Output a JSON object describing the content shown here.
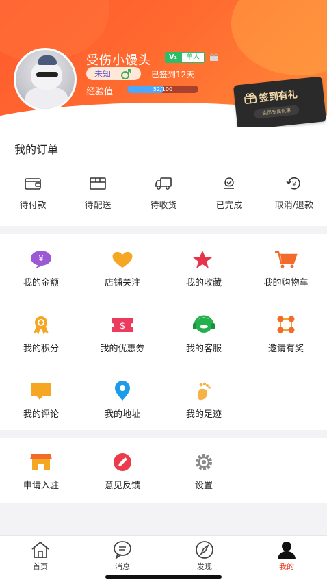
{
  "profile": {
    "username": "受伤小馒头",
    "vip_badge": "V₁",
    "vip_label": "单人",
    "gender_text": "未知",
    "signin_days": "已签到12天",
    "exp_label": "经验值",
    "exp_text": "52/100",
    "exp_progress": 0.52
  },
  "signin_card": {
    "title": "签到有礼",
    "subtitle": "会员专属优惠"
  },
  "orders": {
    "title": "我的订单",
    "items": [
      {
        "label": "待付款",
        "icon": "wallet-icon"
      },
      {
        "label": "待配送",
        "icon": "package-icon"
      },
      {
        "label": "待收货",
        "icon": "truck-icon"
      },
      {
        "label": "已完成",
        "icon": "check-flower-icon"
      },
      {
        "label": "取消/退款",
        "icon": "refund-icon"
      }
    ]
  },
  "services": [
    {
      "label": "我的金额",
      "icon": "money-icon"
    },
    {
      "label": "店铺关注",
      "icon": "heart-icon"
    },
    {
      "label": "我的收藏",
      "icon": "star-icon"
    },
    {
      "label": "我的购物车",
      "icon": "cart-icon"
    },
    {
      "label": "我的积分",
      "icon": "medal-icon"
    },
    {
      "label": "我的优惠券",
      "icon": "coupon-icon"
    },
    {
      "label": "我的客服",
      "icon": "headset-icon"
    },
    {
      "label": "邀请有奖",
      "icon": "invite-icon"
    },
    {
      "label": "我的评论",
      "icon": "comment-icon"
    },
    {
      "label": "我的地址",
      "icon": "location-icon"
    },
    {
      "label": "我的足迹",
      "icon": "footprint-icon"
    }
  ],
  "more": [
    {
      "label": "申请入驻",
      "icon": "store-icon"
    },
    {
      "label": "意见反馈",
      "icon": "feedback-icon"
    },
    {
      "label": "设置",
      "icon": "settings-icon"
    }
  ],
  "tabbar": [
    {
      "label": "首页",
      "icon": "home-icon"
    },
    {
      "label": "消息",
      "icon": "message-icon"
    },
    {
      "label": "发现",
      "icon": "compass-icon"
    },
    {
      "label": "我的",
      "icon": "profile-icon",
      "active": true
    }
  ],
  "colors": {
    "header_orange": "#ff5a2e",
    "active_tab": "#e8402a",
    "exp_bar": "#4aa8ff",
    "vip_green": "#2dbd6a"
  }
}
